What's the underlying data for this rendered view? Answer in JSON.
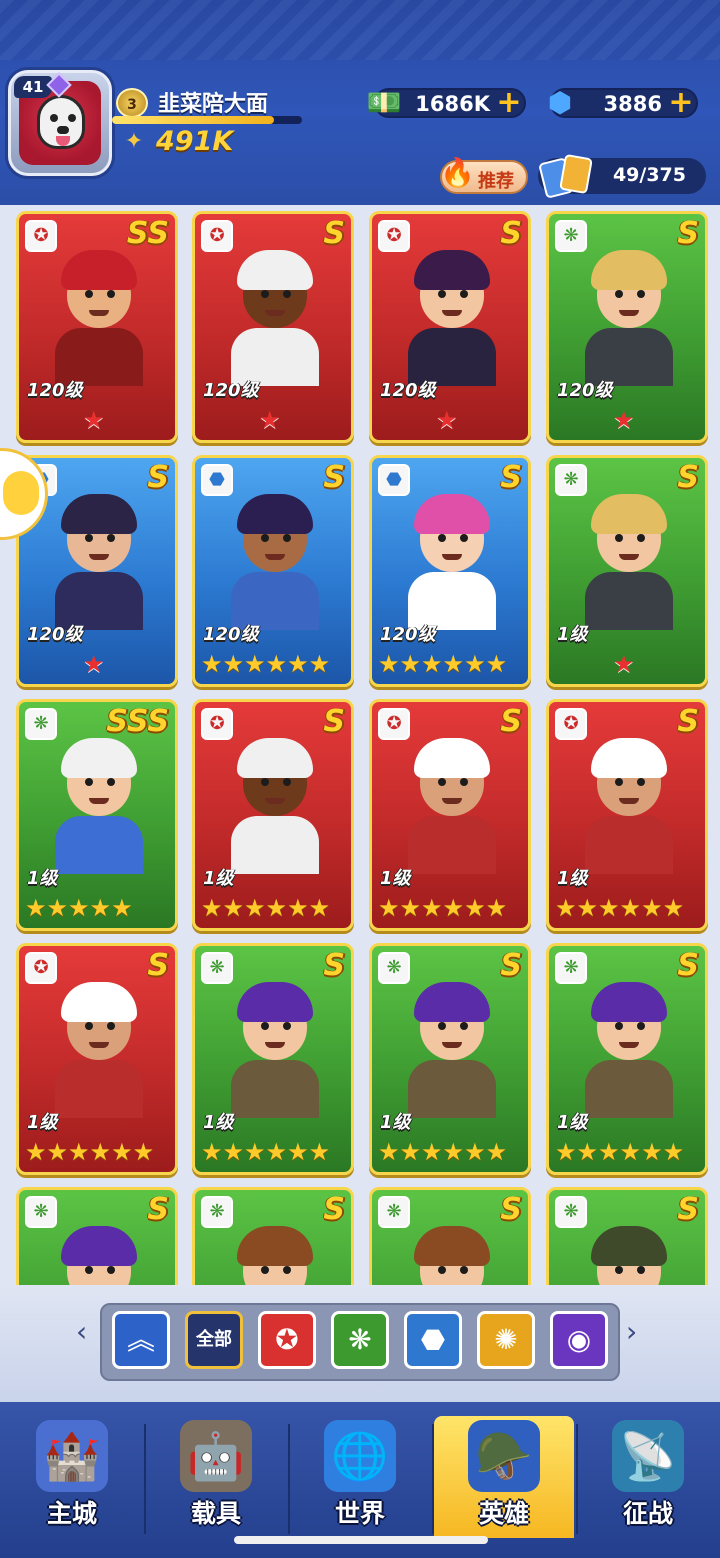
{
  "player": {
    "avatar_level": "41",
    "rank": "3",
    "name": "韭菜陪大面",
    "exp_fraction": 0.85,
    "power": "491K"
  },
  "currencies": [
    {
      "icon": "cash-icon",
      "value": "1686K"
    },
    {
      "icon": "gem-icon",
      "value": "3886"
    }
  ],
  "recommend": {
    "label": "推荐"
  },
  "collection": {
    "count": "49/375"
  },
  "heroes": [
    {
      "faction": "red",
      "grade": "SS",
      "level": "120级",
      "stars": 1,
      "star_type": "red"
    },
    {
      "faction": "red",
      "grade": "S",
      "level": "120级",
      "stars": 1,
      "star_type": "red"
    },
    {
      "faction": "red",
      "grade": "S",
      "level": "120级",
      "stars": 1,
      "star_type": "red"
    },
    {
      "faction": "green",
      "grade": "S",
      "level": "120级",
      "stars": 1,
      "star_type": "red"
    },
    {
      "faction": "blue",
      "grade": "S",
      "level": "120级",
      "stars": 1,
      "star_type": "red"
    },
    {
      "faction": "blue",
      "grade": "S",
      "level": "120级",
      "stars": 6,
      "star_type": "gold"
    },
    {
      "faction": "blue",
      "grade": "S",
      "level": "120级",
      "stars": 6,
      "star_type": "gold"
    },
    {
      "faction": "green",
      "grade": "S",
      "level": "1级",
      "stars": 1,
      "star_type": "red"
    },
    {
      "faction": "green",
      "grade": "SSS",
      "level": "1级",
      "stars": 5,
      "star_type": "gold"
    },
    {
      "faction": "red",
      "grade": "S",
      "level": "1级",
      "stars": 6,
      "star_type": "gold"
    },
    {
      "faction": "red",
      "grade": "S",
      "level": "1级",
      "stars": 6,
      "star_type": "gold"
    },
    {
      "faction": "red",
      "grade": "S",
      "level": "1级",
      "stars": 6,
      "star_type": "gold"
    },
    {
      "faction": "red",
      "grade": "S",
      "level": "1级",
      "stars": 6,
      "star_type": "gold"
    },
    {
      "faction": "green",
      "grade": "S",
      "level": "1级",
      "stars": 6,
      "star_type": "gold"
    },
    {
      "faction": "green",
      "grade": "S",
      "level": "1级",
      "stars": 6,
      "star_type": "gold"
    },
    {
      "faction": "green",
      "grade": "S",
      "level": "1级",
      "stars": 6,
      "star_type": "gold"
    },
    {
      "faction": "green",
      "grade": "S",
      "level": "",
      "stars": 0,
      "star_type": "gold"
    },
    {
      "faction": "green",
      "grade": "S",
      "level": "",
      "stars": 0,
      "star_type": "gold"
    },
    {
      "faction": "green",
      "grade": "S",
      "level": "",
      "stars": 0,
      "star_type": "gold"
    },
    {
      "faction": "green",
      "grade": "S",
      "level": "",
      "stars": 0,
      "star_type": "gold"
    }
  ],
  "filters": [
    {
      "name": "upgrade-filter",
      "icon": "chevron-up-icon",
      "color": "#2d63c9",
      "label": ""
    },
    {
      "name": "all-filter",
      "icon": "",
      "color": "#26346c",
      "label": "全部"
    },
    {
      "name": "red-faction-filter",
      "icon": "red-emblem-icon",
      "color": "#d93030",
      "label": ""
    },
    {
      "name": "green-faction-filter",
      "icon": "green-emblem-icon",
      "color": "#3c9a2e",
      "label": ""
    },
    {
      "name": "blue-faction-filter",
      "icon": "blue-emblem-icon",
      "color": "#2f78d0",
      "label": ""
    },
    {
      "name": "gold-faction-filter",
      "icon": "gold-emblem-icon",
      "color": "#e7a51e",
      "label": ""
    },
    {
      "name": "purple-faction-filter",
      "icon": "purple-emblem-icon",
      "color": "#6a36c0",
      "label": ""
    }
  ],
  "nav": [
    {
      "name": "nav-main-city",
      "label": "主城",
      "active": false
    },
    {
      "name": "nav-vehicles",
      "label": "载具",
      "active": false
    },
    {
      "name": "nav-world",
      "label": "世界",
      "active": false
    },
    {
      "name": "nav-heroes",
      "label": "英雄",
      "active": true
    },
    {
      "name": "nav-campaign",
      "label": "征战",
      "active": false
    }
  ]
}
